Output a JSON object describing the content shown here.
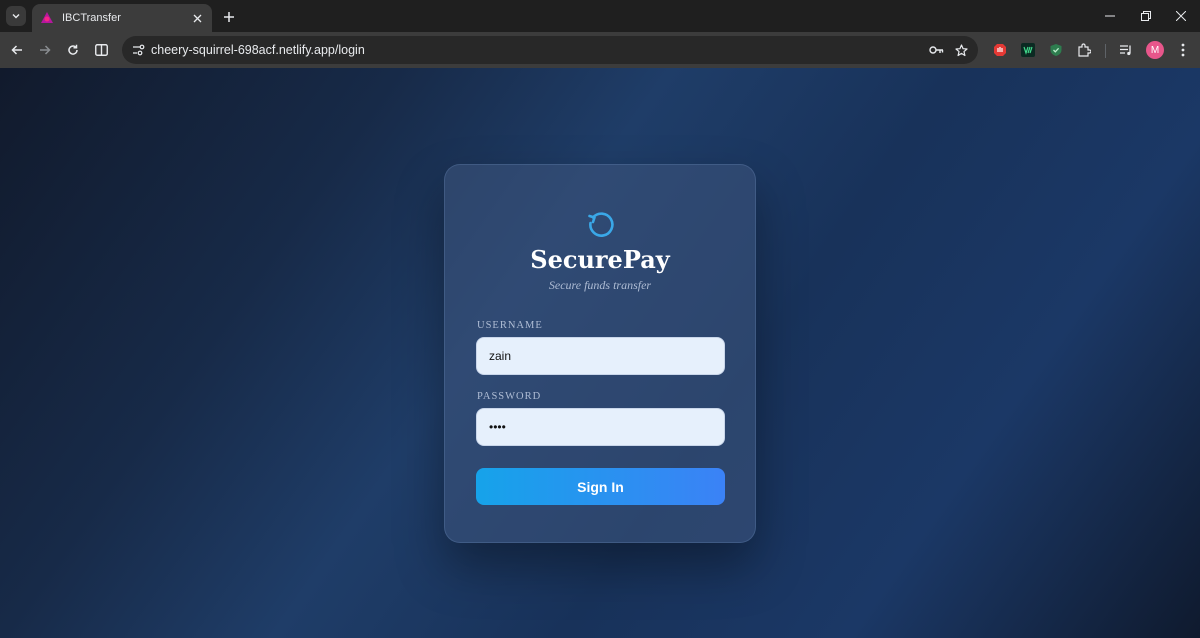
{
  "browser": {
    "tab": {
      "title": "IBCTransfer",
      "favicon": "app-favicon-icon"
    },
    "url": "cheery-squirrel-698acf.netlify.app/login",
    "profile_initial": "M",
    "icons": [
      "tab-search-icon",
      "close-icon",
      "new-tab-icon",
      "minimize-icon",
      "restore-icon",
      "window-close-icon",
      "back-icon",
      "forward-icon",
      "reload-icon",
      "split-view-icon",
      "site-info-icon",
      "password-key-icon",
      "bookmark-star-icon",
      "extensions-icon",
      "media-controls-icon",
      "menu-icon"
    ]
  },
  "login": {
    "brand": "SecurePay",
    "tagline": "Secure funds transfer",
    "username_label": "USERNAME",
    "username_value": "zain",
    "password_label": "PASSWORD",
    "password_value": "zain",
    "submit_label": "Sign In"
  },
  "colors": {
    "accent": "#3b82f6",
    "accent_start": "#16a3ea",
    "field_bg": "#e6f0fc",
    "page_bg": "#1b3866",
    "avatar": "#e8568b"
  }
}
